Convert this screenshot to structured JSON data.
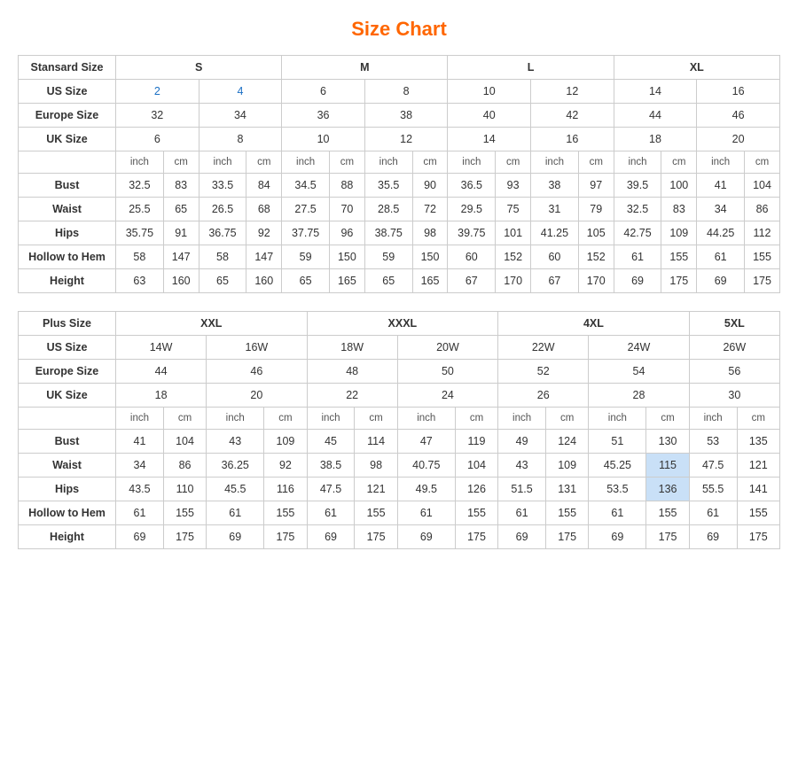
{
  "title": "Size Chart",
  "standard": {
    "headers": {
      "sizeType": "Stansard Size",
      "cols": [
        "S",
        "M",
        "L",
        "XL"
      ]
    },
    "usSize": {
      "label": "US Size",
      "values": [
        "2",
        "4",
        "6",
        "8",
        "10",
        "12",
        "14",
        "16"
      ]
    },
    "europeSize": {
      "label": "Europe Size",
      "values": [
        "32",
        "34",
        "36",
        "38",
        "40",
        "42",
        "44",
        "46"
      ]
    },
    "ukSize": {
      "label": "UK Size",
      "values": [
        "6",
        "8",
        "10",
        "12",
        "14",
        "16",
        "18",
        "20"
      ]
    },
    "unitRow": [
      "inch",
      "cm",
      "inch",
      "cm",
      "inch",
      "cm",
      "inch",
      "cm",
      "inch",
      "cm",
      "inch",
      "cm",
      "inch",
      "cm",
      "inch",
      "cm"
    ],
    "bust": {
      "label": "Bust",
      "values": [
        "32.5",
        "83",
        "33.5",
        "84",
        "34.5",
        "88",
        "35.5",
        "90",
        "36.5",
        "93",
        "38",
        "97",
        "39.5",
        "100",
        "41",
        "104"
      ]
    },
    "waist": {
      "label": "Waist",
      "values": [
        "25.5",
        "65",
        "26.5",
        "68",
        "27.5",
        "70",
        "28.5",
        "72",
        "29.5",
        "75",
        "31",
        "79",
        "32.5",
        "83",
        "34",
        "86"
      ]
    },
    "hips": {
      "label": "Hips",
      "values": [
        "35.75",
        "91",
        "36.75",
        "92",
        "37.75",
        "96",
        "38.75",
        "98",
        "39.75",
        "101",
        "41.25",
        "105",
        "42.75",
        "109",
        "44.25",
        "112"
      ]
    },
    "hollow": {
      "label": "Hollow to Hem",
      "values": [
        "58",
        "147",
        "58",
        "147",
        "59",
        "150",
        "59",
        "150",
        "60",
        "152",
        "60",
        "152",
        "61",
        "155",
        "61",
        "155"
      ]
    },
    "height": {
      "label": "Height",
      "values": [
        "63",
        "160",
        "65",
        "160",
        "65",
        "165",
        "65",
        "165",
        "67",
        "170",
        "67",
        "170",
        "69",
        "175",
        "69",
        "175"
      ]
    }
  },
  "plus": {
    "headers": {
      "sizeType": "Plus Size",
      "cols": [
        "XXL",
        "XXXL",
        "4XL",
        "5XL"
      ]
    },
    "usSize": {
      "label": "US Size",
      "values": [
        "14W",
        "16W",
        "18W",
        "20W",
        "22W",
        "24W",
        "26W"
      ]
    },
    "europeSize": {
      "label": "Europe Size",
      "values": [
        "44",
        "46",
        "48",
        "50",
        "52",
        "54",
        "56"
      ]
    },
    "ukSize": {
      "label": "UK Size",
      "values": [
        "18",
        "20",
        "22",
        "24",
        "26",
        "28",
        "30"
      ]
    },
    "unitRow": [
      "inch",
      "cm",
      "inch",
      "cm",
      "inch",
      "cm",
      "inch",
      "cm",
      "inch",
      "cm",
      "inch",
      "cm",
      "inch",
      "cm"
    ],
    "bust": {
      "label": "Bust",
      "values": [
        "41",
        "104",
        "43",
        "109",
        "45",
        "114",
        "47",
        "119",
        "49",
        "124",
        "51",
        "130",
        "53",
        "135"
      ]
    },
    "waist": {
      "label": "Waist",
      "values": [
        "34",
        "86",
        "36.25",
        "92",
        "38.5",
        "98",
        "40.75",
        "104",
        "43",
        "109",
        "45.25",
        "115",
        "47.5",
        "121"
      ]
    },
    "hips": {
      "label": "Hips",
      "values": [
        "43.5",
        "110",
        "45.5",
        "116",
        "47.5",
        "121",
        "49.5",
        "126",
        "51.5",
        "131",
        "53.5",
        "136",
        "55.5",
        "141"
      ]
    },
    "hollow": {
      "label": "Hollow to Hem",
      "values": [
        "61",
        "155",
        "61",
        "155",
        "61",
        "155",
        "61",
        "155",
        "61",
        "155",
        "61",
        "155",
        "61",
        "155"
      ]
    },
    "height": {
      "label": "Height",
      "values": [
        "69",
        "175",
        "69",
        "175",
        "69",
        "175",
        "69",
        "175",
        "69",
        "175",
        "69",
        "175",
        "69",
        "175"
      ]
    }
  }
}
